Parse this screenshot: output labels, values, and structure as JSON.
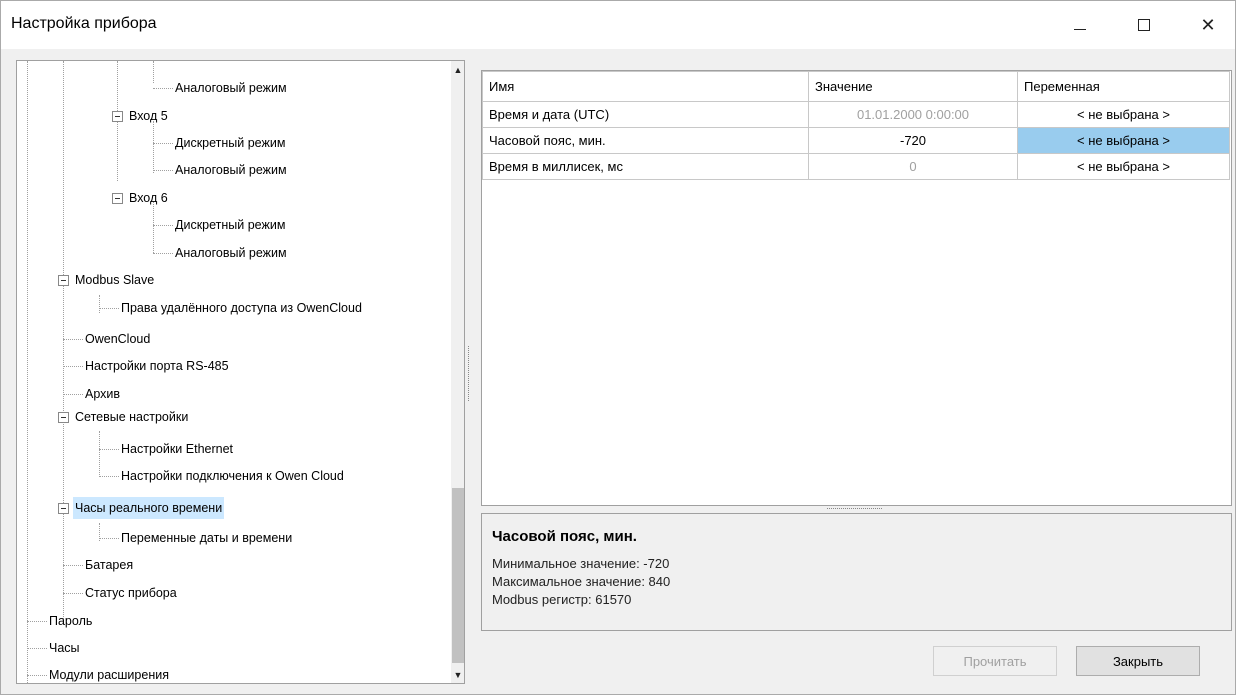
{
  "window": {
    "title": "Настройка прибора",
    "minimize_glyph": "—",
    "maximize_glyph": "☐",
    "close_glyph": "✕"
  },
  "tree": {
    "items": [
      {
        "label": "Аналоговый режим"
      },
      {
        "label": "Вход 5"
      },
      {
        "label": "Дискретный режим"
      },
      {
        "label": "Аналоговый режим"
      },
      {
        "label": "Вход 6"
      },
      {
        "label": "Дискретный режим"
      },
      {
        "label": "Аналоговый режим"
      },
      {
        "label": "Modbus Slave"
      },
      {
        "label": "Права удалённого доступа из OwenCloud"
      },
      {
        "label": "OwenCloud"
      },
      {
        "label": "Настройки порта RS-485"
      },
      {
        "label": "Архив"
      },
      {
        "label": "Сетевые настройки"
      },
      {
        "label": "Настройки Ethernet"
      },
      {
        "label": "Настройки подключения к Owen Cloud"
      },
      {
        "label": "Часы реального времени",
        "selected": true
      },
      {
        "label": "Переменные даты и времени"
      },
      {
        "label": "Батарея"
      },
      {
        "label": "Статус прибора"
      },
      {
        "label": "Пароль"
      },
      {
        "label": "Часы"
      },
      {
        "label": "Модули расширения"
      }
    ],
    "scroll_up_glyph": "▲",
    "scroll_down_glyph": "▼"
  },
  "grid": {
    "headers": {
      "name": "Имя",
      "value": "Значение",
      "variable": "Переменная"
    },
    "rows": [
      {
        "name": "Время и дата (UTC)",
        "value": "01.01.2000 0:00:00",
        "variable": "< не выбрана >"
      },
      {
        "name": "Часовой пояс, мин.",
        "value": "-720",
        "variable": "< не выбрана >"
      },
      {
        "name": "Время в миллисек, мс",
        "value": "0",
        "variable": "< не выбрана >"
      }
    ]
  },
  "description": {
    "title": "Часовой пояс, мин.",
    "lines": [
      "Минимальное значение: -720",
      "Максимальное значение: 840",
      "Modbus регистр: 61570"
    ]
  },
  "buttons": {
    "read": "Прочитать",
    "close": "Закрыть"
  }
}
